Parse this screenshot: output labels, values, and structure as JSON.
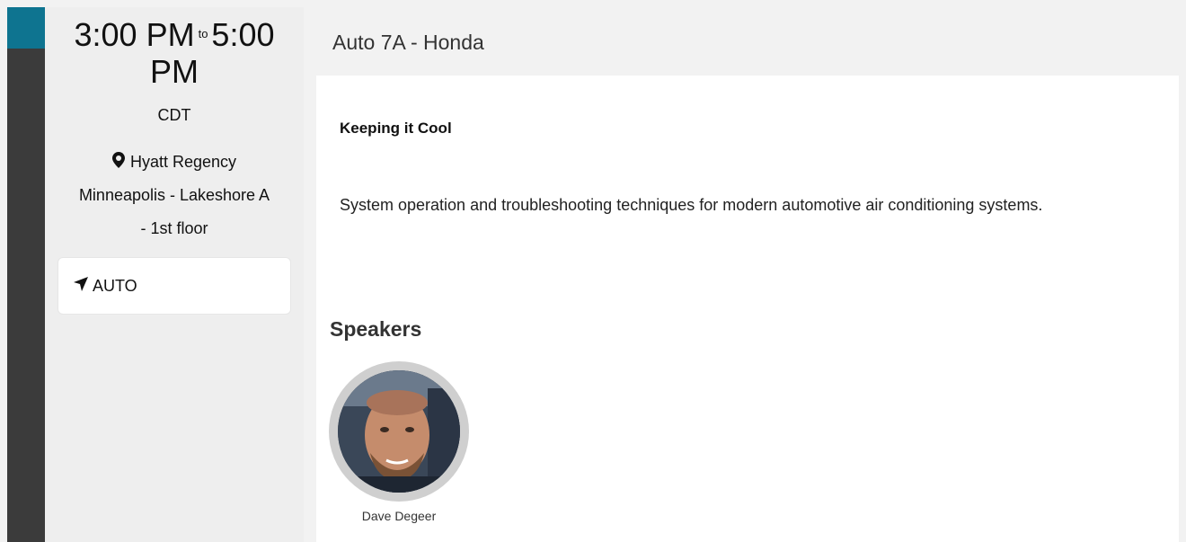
{
  "session": {
    "start_time": "3:00 PM",
    "to_label": "to",
    "end_time_line1": "5:00",
    "end_time_line2": "PM",
    "timezone": "CDT",
    "location_line1": "Hyatt Regency",
    "location_line2": "Minneapolis - Lakeshore A",
    "location_line3": "- 1st floor",
    "track": "AUTO"
  },
  "main": {
    "header_title": "Auto 7A - Honda",
    "title": "Keeping it Cool",
    "description": "System operation and troubleshooting techniques for modern automotive air conditioning systems.",
    "speakers_heading": "Speakers",
    "speakers": [
      {
        "name": "Dave Degeer"
      }
    ]
  },
  "icons": {
    "location": "map-pin-icon",
    "track": "navigation-arrow-icon"
  },
  "colors": {
    "accent": "#0e7490",
    "dark_strip": "#3b3b3b"
  }
}
